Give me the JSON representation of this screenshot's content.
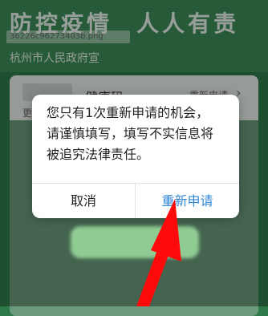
{
  "banner": {
    "title_left": "防控疫情",
    "title_right": "人人有责",
    "subtitle": "杭州市人民政府宣",
    "watermark": "36226c96273403b.png"
  },
  "card": {
    "title": "健康码",
    "link": "重新申请",
    "note": "更"
  },
  "dialog": {
    "message_lines": [
      "您只有1次重新申请的机会，",
      "请谨慎填写，填写不实信息将",
      "被追究法律责任。"
    ],
    "cancel_label": "取消",
    "reapply_label": "重新申请"
  },
  "colors": {
    "background_green": "#2f7a4a",
    "accent_blue": "#2f86d6",
    "arrow_red": "#ff0a0a"
  },
  "icons": {
    "card_chevron": "chevron-right-icon",
    "annotation": "red-arrow-icon"
  }
}
